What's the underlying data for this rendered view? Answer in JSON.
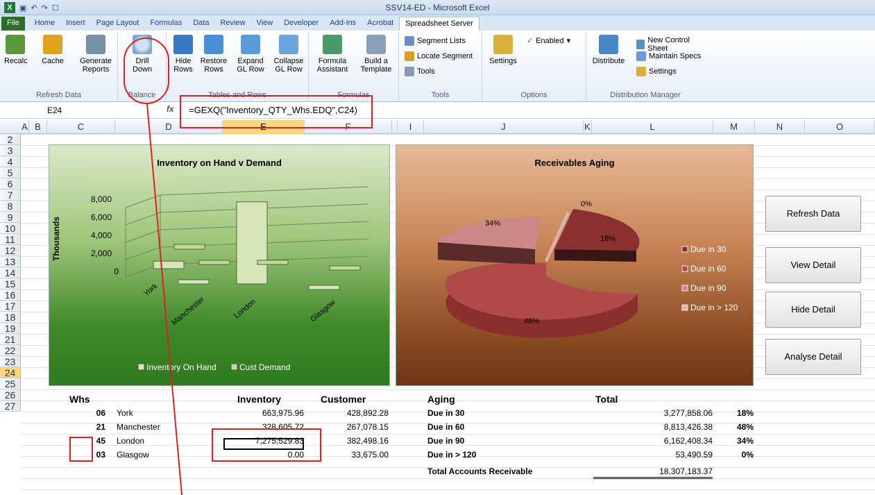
{
  "window": {
    "title": "SSV14-ED  -  Microsoft Excel"
  },
  "tabs": [
    "File",
    "Home",
    "Insert",
    "Page Layout",
    "Formulas",
    "Data",
    "Review",
    "View",
    "Developer",
    "Add-Ins",
    "Acrobat",
    "Spreadsheet Server"
  ],
  "active_tab": "Spreadsheet Server",
  "ribbon": {
    "groups": {
      "refresh": "Refresh Data",
      "balance": "Balance",
      "tables": "Tables and Rows",
      "formulas": "Formulas",
      "tools": "Tools",
      "options": "Options",
      "distribution": "Distribution Manager"
    },
    "buttons": {
      "recalc": "Recalc",
      "cache": "Cache",
      "generate_reports": "Generate Reports",
      "drill_down": "Drill Down",
      "hide_rows": "Hide Rows",
      "restore_rows": "Restore Rows",
      "expand_gl": "Expand GL Row",
      "collapse_gl": "Collapse GL Row",
      "formula_assistant": "Formula Assistant",
      "build_template": "Build a Template",
      "segment_lists": "Segment Lists",
      "locate_segment": "Locate Segment",
      "tools": "Tools",
      "settings": "Settings",
      "enabled": "Enabled",
      "distribute": "Distribute",
      "new_control_sheet": "New Control Sheet",
      "maintain_specs": "Maintain Specs",
      "dm_settings": "Settings"
    }
  },
  "formula_bar": {
    "name_box": "E24",
    "fx": "fx",
    "formula": "=GEXQ(\"Inventory_QTY_Whs.EDQ\",C24)"
  },
  "columns": [
    "A",
    "B",
    "C",
    "D",
    "E",
    "F",
    "",
    "I",
    "J",
    "K",
    "L",
    "M",
    "N",
    "O"
  ],
  "rows": [
    "2",
    "3",
    "4",
    "5",
    "6",
    "7",
    "8",
    "9",
    "10",
    "11",
    "12",
    "13",
    "14",
    "15",
    "16",
    "17",
    "18",
    "19",
    "21",
    "22",
    "23",
    "24",
    "25",
    "26",
    "27"
  ],
  "chart1": {
    "title": "Inventory on Hand v Demand",
    "ylabel": "Thousands",
    "ticks": [
      "8,000",
      "6,000",
      "4,000",
      "2,000",
      "0"
    ],
    "categories": [
      "York",
      "Manchester",
      "London",
      "Glasgow"
    ],
    "legend": [
      "Inventory On Hand",
      "Cust Demand"
    ]
  },
  "chart2": {
    "title": "Receivables Aging",
    "labels": [
      "0%",
      "34%",
      "18%",
      "48%"
    ],
    "legend": [
      "Due in 30",
      "Due in 60",
      "Due in 90",
      "Due in > 120"
    ]
  },
  "chart_data": [
    {
      "type": "bar",
      "title": "Inventory on Hand v Demand",
      "ylabel": "Thousands",
      "categories": [
        "York",
        "Manchester",
        "London",
        "Glasgow"
      ],
      "series": [
        {
          "name": "Inventory On Hand",
          "values": [
            663.98,
            328.61,
            7275.53,
            0
          ]
        },
        {
          "name": "Cust Demand",
          "values": [
            428.89,
            267.08,
            382.5,
            33.68
          ]
        }
      ],
      "ylim": [
        0,
        8000
      ]
    },
    {
      "type": "pie",
      "title": "Receivables Aging",
      "categories": [
        "Due in 30",
        "Due in 60",
        "Due in 90",
        "Due in > 120"
      ],
      "values": [
        18,
        48,
        34,
        0
      ]
    }
  ],
  "buttons": [
    "Refresh Data",
    "View Detail",
    "Hide Detail",
    "Analyse Detail"
  ],
  "table1": {
    "headers": [
      "Whs",
      "",
      "Inventory",
      "Customer"
    ],
    "rows": [
      [
        "06",
        "York",
        "663,975.96",
        "428,892.28"
      ],
      [
        "21",
        "Manchester",
        "328,605.72",
        "267,078.15"
      ],
      [
        "45",
        "London",
        "7,275,529.83",
        "382,498.16"
      ],
      [
        "03",
        "Glasgow",
        "0.00",
        "33,675.00"
      ]
    ]
  },
  "table2": {
    "headers": [
      "Aging",
      "Total"
    ],
    "rows": [
      [
        "Due in 30",
        "3,277,858.06",
        "18%"
      ],
      [
        "Due in 60",
        "8,813,426.38",
        "48%"
      ],
      [
        "Due in 90",
        "6,162,408.34",
        "34%"
      ],
      [
        "Due in > 120",
        "53,490.59",
        "0%"
      ]
    ],
    "total_label": "Total Accounts Receivable",
    "total_value": "18,307,183.37"
  }
}
